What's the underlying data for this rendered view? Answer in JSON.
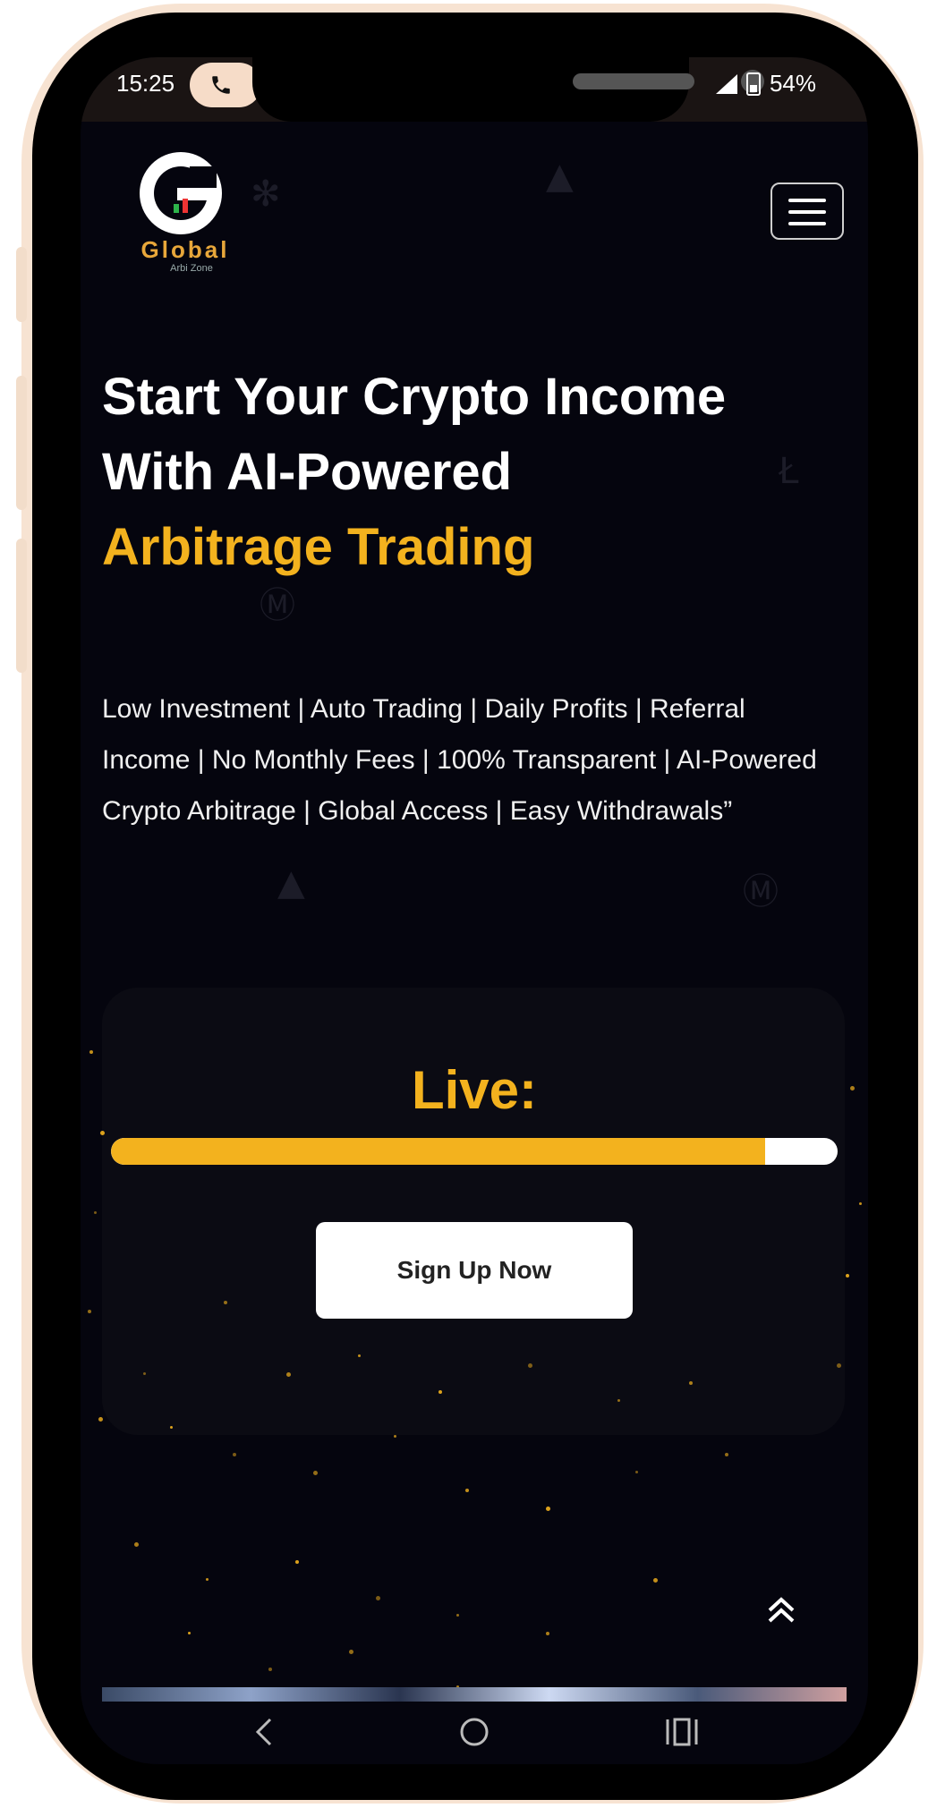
{
  "status_bar": {
    "time": "15:25",
    "battery": "54%",
    "icons": [
      "phone-call-icon",
      "signal-icon",
      "battery-icon"
    ]
  },
  "header": {
    "logo_text": "Global",
    "logo_subtext": "Arbi Zone",
    "menu_icon": "hamburger-menu-icon"
  },
  "hero": {
    "title_line1": "Start Your Crypto Income",
    "title_line2": "With AI-Powered",
    "title_highlight": "Arbitrage Trading",
    "description": "Low Investment | Auto Trading | Daily Profits | Referral Income | No Monthly Fees | 100% Transparent | AI-Powered Crypto Arbitrage | Global Access | Easy Withdrawals”"
  },
  "live": {
    "label": "Live:",
    "progress_percent": 90,
    "signup_label": "Sign Up Now"
  },
  "colors": {
    "accent": "#f3b21e",
    "background": "#05050e",
    "frame": "#f7e3d2"
  },
  "scroll_top_icon": "double-chevron-up-icon",
  "nav_bar": {
    "icons": [
      "back-icon",
      "home-icon",
      "recents-icon"
    ]
  }
}
